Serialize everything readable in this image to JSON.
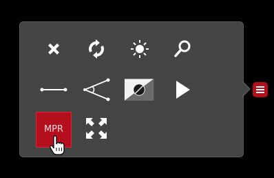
{
  "toolbar": {
    "row1": [
      {
        "icon": "close-icon",
        "label": ""
      },
      {
        "icon": "rotate-icon",
        "label": ""
      },
      {
        "icon": "brightness-icon",
        "label": ""
      },
      {
        "icon": "zoom-icon",
        "label": ""
      }
    ],
    "row2": [
      {
        "icon": "length-measure-icon",
        "label": ""
      },
      {
        "icon": "angle-measure-icon",
        "label": ""
      },
      {
        "icon": "invert-icon",
        "label": ""
      },
      {
        "icon": "play-icon",
        "label": ""
      }
    ],
    "row3": [
      {
        "icon": "mpr-button",
        "label": "MPR"
      },
      {
        "icon": "fullscreen-icon",
        "label": ""
      }
    ]
  },
  "mpr_label": "MPR",
  "colors": {
    "panel": "#444444",
    "accent": "#b50e1c",
    "icon": "#ffffff"
  }
}
